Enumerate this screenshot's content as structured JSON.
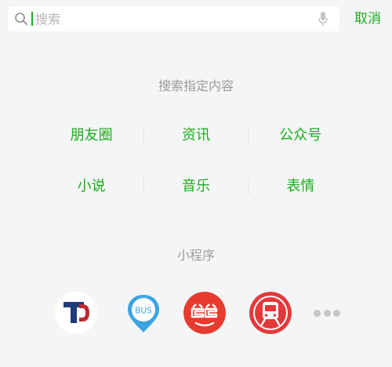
{
  "search": {
    "placeholder": "搜索",
    "value": "",
    "cancel_label": "取消"
  },
  "section_content": {
    "title": "搜索指定内容",
    "rows": [
      [
        "朋友圈",
        "资讯",
        "公众号"
      ],
      [
        "小说",
        "音乐",
        "表情"
      ]
    ]
  },
  "section_apps": {
    "title": "小程序",
    "apps": [
      {
        "icon": "app-t-logo-icon"
      },
      {
        "icon": "bus-pin-icon",
        "label": "BUS"
      },
      {
        "icon": "dangdang-icon"
      },
      {
        "icon": "metro-train-icon"
      }
    ],
    "more_icon": "more-dots-icon"
  },
  "colors": {
    "accent": "#1aad19",
    "muted_text": "#9b9b9b",
    "background": "#f4f5f6"
  }
}
